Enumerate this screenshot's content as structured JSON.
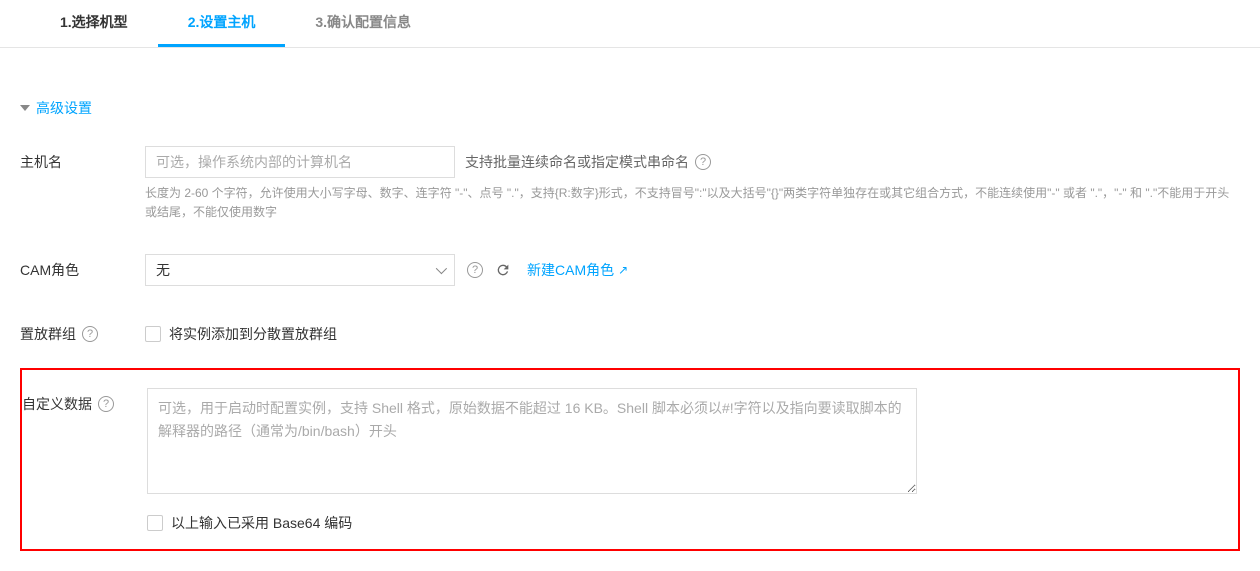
{
  "tabs": {
    "step1": "1.选择机型",
    "step2": "2.设置主机",
    "step3": "3.确认配置信息"
  },
  "advanced_settings_label": "高级设置",
  "hostname": {
    "label": "主机名",
    "placeholder": "可选，操作系统内部的计算机名",
    "hint": "支持批量连续命名或指定模式串命名",
    "desc": "长度为 2-60 个字符，允许使用大小写字母、数字、连字符 \"-\"、点号 \".\"，支持{R:数字}形式，不支持冒号\":\"以及大括号\"{}\"两类字符单独存在或其它组合方式，不能连续使用\"-\" 或者 \".\"，\"-\" 和 \".\"不能用于开头或结尾，不能仅使用数字"
  },
  "cam_role": {
    "label": "CAM角色",
    "selected": "无",
    "link_text": "新建CAM角色"
  },
  "placement_group": {
    "label": "置放群组",
    "checkbox_label": "将实例添加到分散置放群组"
  },
  "custom_data": {
    "label": "自定义数据",
    "placeholder": "可选，用于启动时配置实例，支持 Shell 格式，原始数据不能超过 16 KB。Shell 脚本必须以#!字符以及指向要读取脚本的解释器的路径（通常为/bin/bash）开头",
    "base64_label": "以上输入已采用 Base64 编码"
  }
}
